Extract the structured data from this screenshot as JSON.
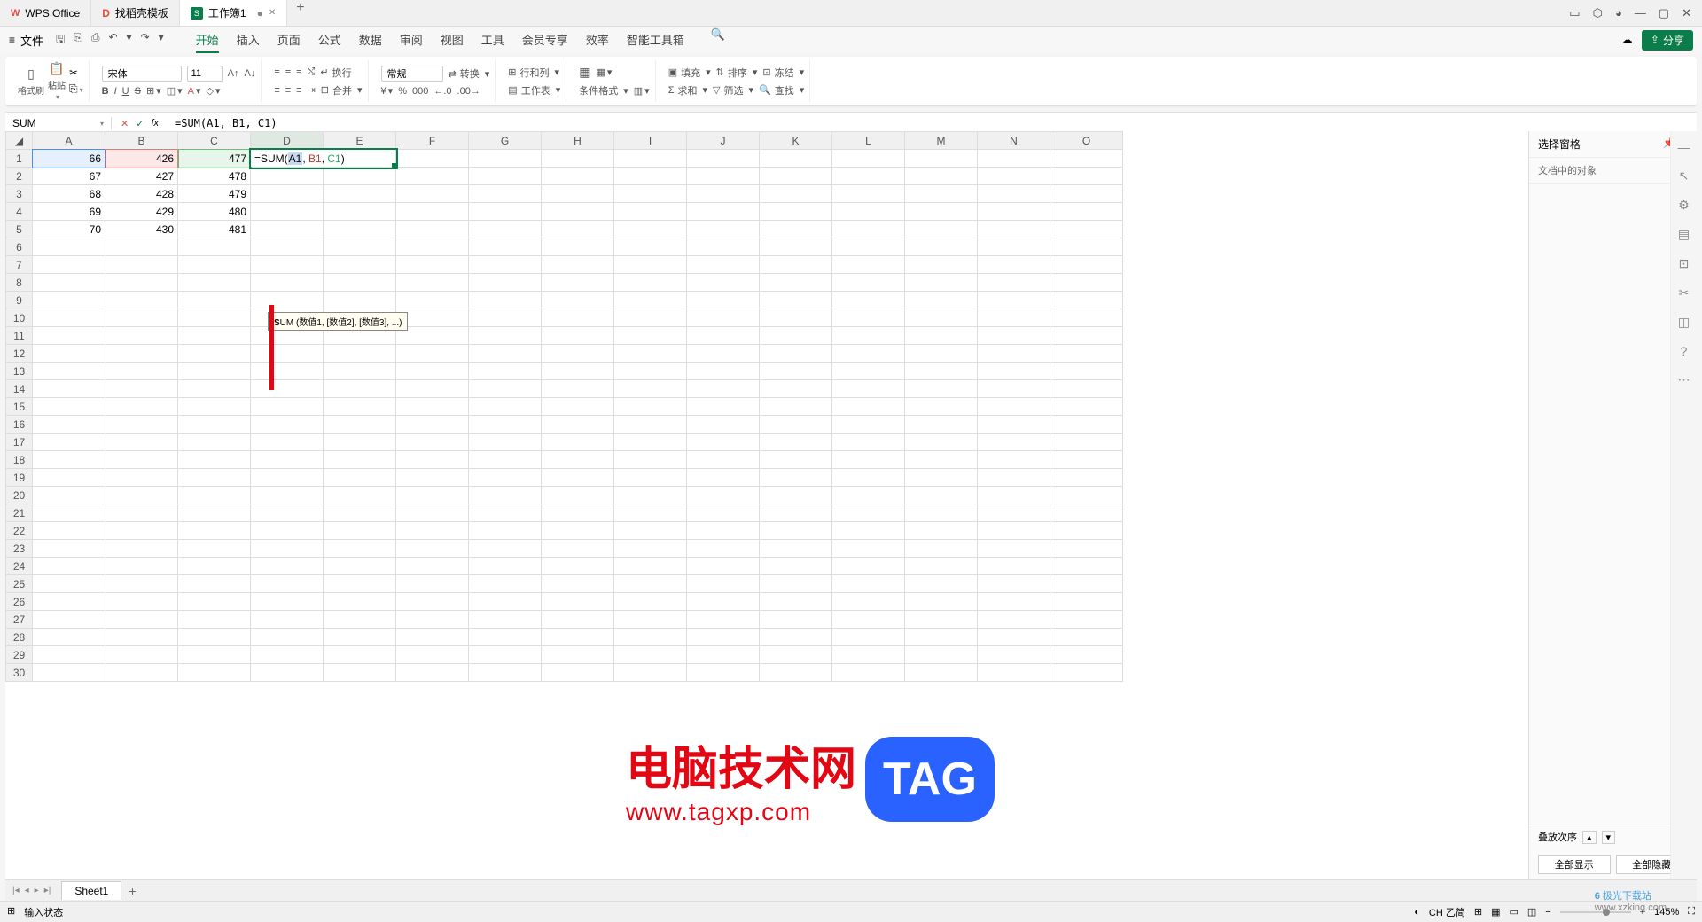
{
  "title_bar": {
    "app_name": "WPS Office",
    "template_tab": "找稻壳模板",
    "workbook_tab": "工作簿1",
    "add_tab": "+"
  },
  "window_controls": {
    "b1": "▭",
    "b2": "⬡",
    "b3": "◕",
    "min": "—",
    "max": "▢",
    "close": "✕"
  },
  "menu": {
    "file": "文件",
    "tabs": [
      "开始",
      "插入",
      "页面",
      "公式",
      "数据",
      "审阅",
      "视图",
      "工具",
      "会员专享",
      "效率",
      "智能工具箱"
    ],
    "active_index": 0,
    "cloud_icon": "☁",
    "share": "分享"
  },
  "ribbon": {
    "paste": "粘贴",
    "format_brush": "格式刷",
    "cut": "✂",
    "font_name": "宋体",
    "font_size": "11",
    "bold": "B",
    "italic": "I",
    "underline": "U",
    "strike": "S",
    "number_format": "常规",
    "convert": "转换",
    "rowcol": "行和列",
    "worksheet": "工作表",
    "table": "▦",
    "chart": "⊞",
    "cond_format": "条件格式",
    "fill": "填充",
    "sort": "排序",
    "freeze": "冻结",
    "sum": "求和",
    "filter": "筛选",
    "find": "查找",
    "wrap": "换行",
    "merge": "合并"
  },
  "formula_bar": {
    "name_box": "SUM",
    "formula": "=SUM(A1, B1, C1)"
  },
  "sheet": {
    "columns": [
      "A",
      "B",
      "C",
      "D",
      "E",
      "F",
      "G",
      "H",
      "I",
      "J",
      "K",
      "L",
      "M",
      "N",
      "O"
    ],
    "rows": [
      1,
      2,
      3,
      4,
      5,
      6,
      7,
      8,
      9,
      10,
      11,
      12,
      13,
      14,
      15,
      16,
      17,
      18,
      19,
      20,
      21,
      22,
      23,
      24,
      25,
      26,
      27,
      28,
      29,
      30
    ],
    "data": {
      "A": [
        66,
        67,
        68,
        69,
        70
      ],
      "B": [
        426,
        427,
        428,
        429,
        430
      ],
      "C": [
        477,
        478,
        479,
        480,
        481
      ]
    },
    "editing_cell": "D1",
    "editing_content": {
      "pre": "=SUM(",
      "a": "A1",
      "sep1": ", ",
      "b": "B1",
      "sep2": ", ",
      "c": "C1",
      "post": ")"
    },
    "tooltip": "UM (数值1, [数值2], [数值3], ...)"
  },
  "side_panel": {
    "title": "选择窗格",
    "sub": "文档中的对象",
    "stack": "叠放次序",
    "show_all": "全部显示",
    "hide_all": "全部隐藏",
    "pin": "📌",
    "close": "✕"
  },
  "sheet_tabs": {
    "sheet1": "Sheet1"
  },
  "status": {
    "mode": "输入状态",
    "ime": "CH 乙简",
    "zoom": "145%"
  },
  "watermark": {
    "cn": "电脑技术网",
    "url": "www.tagxp.com",
    "tag": "TAG"
  },
  "bottom_logo": {
    "brand": "极光下载站",
    "url": "www.xzking.com"
  }
}
